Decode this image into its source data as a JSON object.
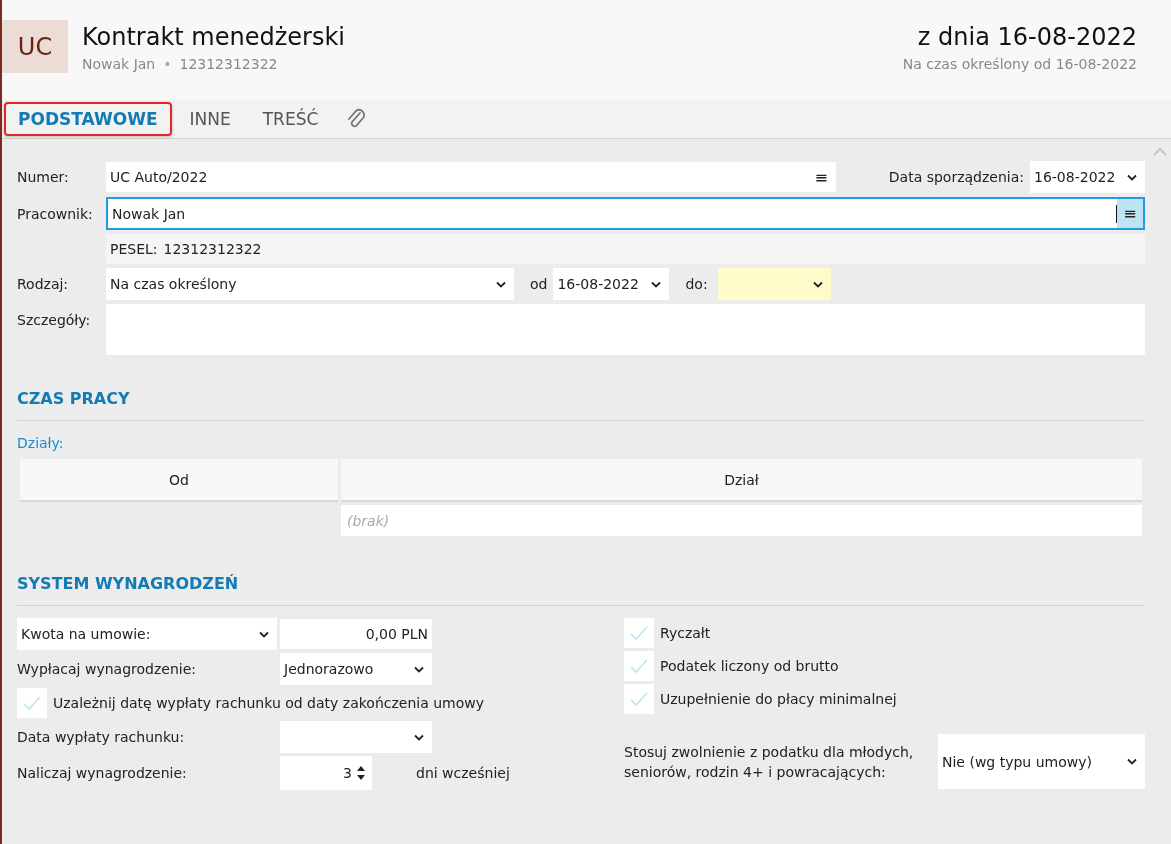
{
  "header": {
    "badge": "UC",
    "title": "Kontrakt menedżerski",
    "subtitle_name": "Nowak Jan",
    "subtitle_separator": "•",
    "subtitle_id": "12312312322",
    "date": "z dnia 16-08-2022",
    "period": "Na czas określony od 16-08-2022"
  },
  "tabs": [
    {
      "kind": "text",
      "label": "PODSTAWOWE",
      "selected": true
    },
    {
      "kind": "text",
      "label": "INNE",
      "selected": false
    },
    {
      "kind": "text",
      "label": "TREŚĆ",
      "selected": false
    },
    {
      "kind": "attachment",
      "selected": false
    }
  ],
  "form": {
    "numer_label": "Numer:",
    "numer_value": "UC Auto/2022",
    "numer_menu": "≡",
    "date_label": "Data sporządzenia:",
    "date_value": "16-08-2022",
    "employee_label": "Pracownik:",
    "employee_value": "Nowak Jan",
    "employee_menu": "≡",
    "pesel_label": "PESEL:",
    "pesel_value": "12312312322",
    "type_label": "Rodzaj:",
    "type_value": "Na czas określony",
    "from_label": "od",
    "from_value": "16-08-2022",
    "to_label": "do:",
    "details_label": "Szczegóły:"
  },
  "work_time": {
    "heading": "CZAS PRACY",
    "departments_label": "Działy:",
    "table": {
      "columns": [
        "Od",
        "Dział"
      ],
      "empty_text": "(brak)"
    }
  },
  "salary": {
    "heading": "SYSTEM WYNAGRODZEŃ",
    "amount_type": "Kwota na umowie:",
    "amount_value": "0,00 PLN",
    "pay_label": "Wypłacaj wynagrodzenie:",
    "pay_value": "Jednorazowo",
    "depend_checkbox": {
      "label": "Uzależnij datę wypłaty rachunku od daty zakończenia umowy",
      "checked": false
    },
    "pay_date_label": "Data wypłaty rachunku:",
    "accrue_label": "Naliczaj wynagrodzenie:",
    "accrue_value": "3",
    "accrue_suffix": "dni wcześniej",
    "options": [
      {
        "label": "Ryczałt",
        "checked": false
      },
      {
        "label": "Podatek liczony od brutto",
        "checked": false
      },
      {
        "label": "Uzupełnienie do płacy minimalnej",
        "checked": false
      }
    ],
    "exemption_label": "Stosuj zwolnienie z podatku dla młodych, seniorów, rodzin 4+ i powracających:",
    "exemption_value": "Nie (wg typu umowy)"
  }
}
